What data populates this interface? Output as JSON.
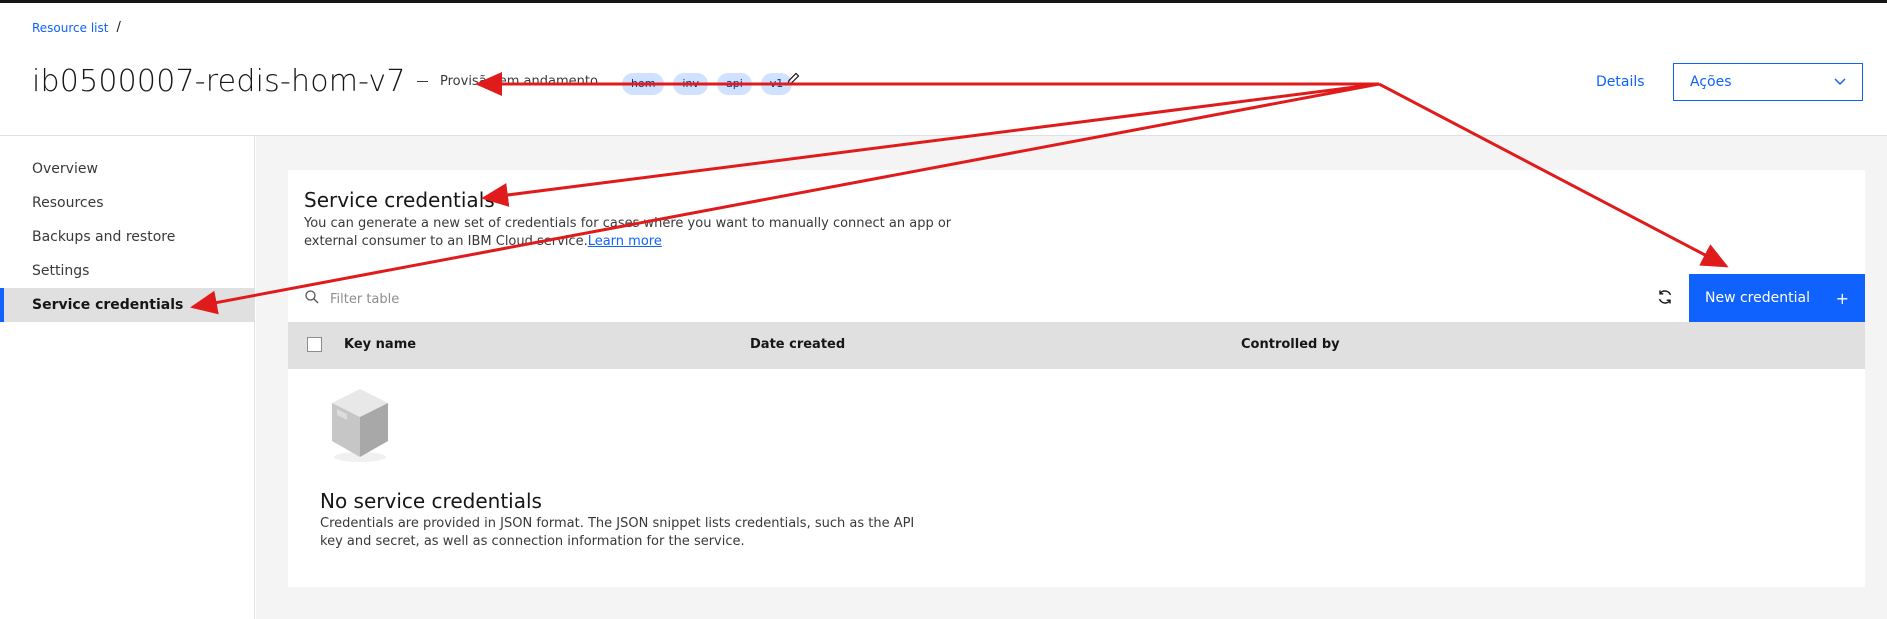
{
  "breadcrumb": {
    "root": "Resource list",
    "separator": "/"
  },
  "header": {
    "title": "ib0500007-redis-hom-v7",
    "status": "Provisão em andamento",
    "tags": [
      "hom",
      "inv",
      "api",
      "v1"
    ],
    "details_label": "Details",
    "actions_label": "Ações"
  },
  "sidebar": {
    "items": [
      {
        "label": "Overview"
      },
      {
        "label": "Resources"
      },
      {
        "label": "Backups and restore"
      },
      {
        "label": "Settings"
      },
      {
        "label": "Service credentials"
      }
    ],
    "active_index": 4
  },
  "section": {
    "title": "Service credentials",
    "description": "You can generate a new set of credentials for cases where you want to manually connect an app or external consumer to an IBM Cloud service.",
    "learn_more": "Learn more"
  },
  "toolbar": {
    "filter_placeholder": "Filter table",
    "new_credential_label": "New credential",
    "new_credential_icon": "+"
  },
  "table": {
    "columns": [
      "Key name",
      "Date created",
      "Controlled by"
    ]
  },
  "empty_state": {
    "title": "No service credentials",
    "description": "Credentials are provided in JSON format. The JSON snippet lists credentials, such as the API key and secret, as well as connection information for the service."
  },
  "colors": {
    "primary": "#0f62fe",
    "annotation": "#e01b1b",
    "background": "#f4f4f4"
  },
  "icons": [
    "edit-icon",
    "chevron-down-icon",
    "search-icon",
    "refresh-icon",
    "plus-icon",
    "empty-box-icon"
  ]
}
